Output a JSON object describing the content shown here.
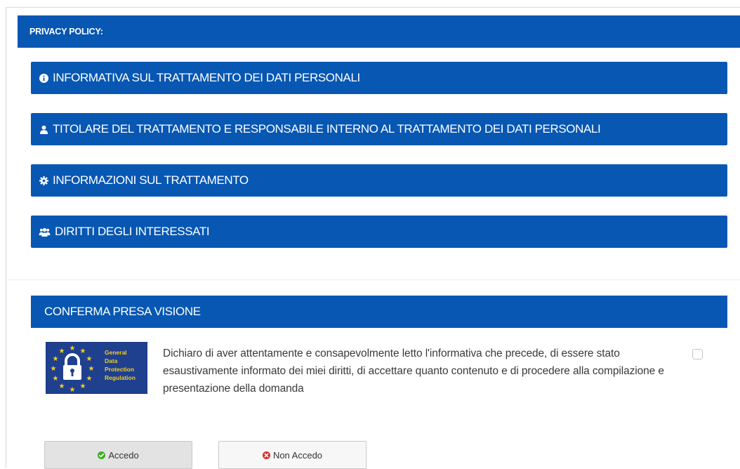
{
  "privacy_header": {
    "title": "PRIVACY POLICY:"
  },
  "accordions": [
    {
      "icon": "info-circle-icon",
      "label": "INFORMATIVA SUL TRATTAMENTO DEI DATI PERSONALI"
    },
    {
      "icon": "user-icon",
      "label": "TITOLARE DEL TRATTAMENTO E RESPONSABILE INTERNO AL TRATTAMENTO DEI DATI PERSONALI"
    },
    {
      "icon": "gear-icon",
      "label": "INFORMAZIONI SUL TRATTAMENTO"
    },
    {
      "icon": "users-icon",
      "label": "DIRITTI DEGLI INTERESSATI"
    }
  ],
  "confirm": {
    "title": "CONFERMA PRESA VISIONE",
    "logo": {
      "icon": "gdpr-lock-logo",
      "text": "General Data Protection Regulation"
    },
    "declaration": "Dichiaro di aver attentamente e consapevolmente letto l'informativa che precede, di essere stato esaustivamente informato dei miei diritti, di accettare quanto contenuto e di procedere alla compilazione e presentazione della domanda",
    "checkbox_checked": false
  },
  "buttons": {
    "accept": {
      "label": "Accedo",
      "icon": "check-circle-icon",
      "icon_color": "#3fae29"
    },
    "decline": {
      "label": "Non Accedo",
      "icon": "times-circle-icon",
      "icon_color": "#d9302c"
    }
  },
  "colors": {
    "primary": "#0757b3",
    "text": "#3a3a3a"
  }
}
